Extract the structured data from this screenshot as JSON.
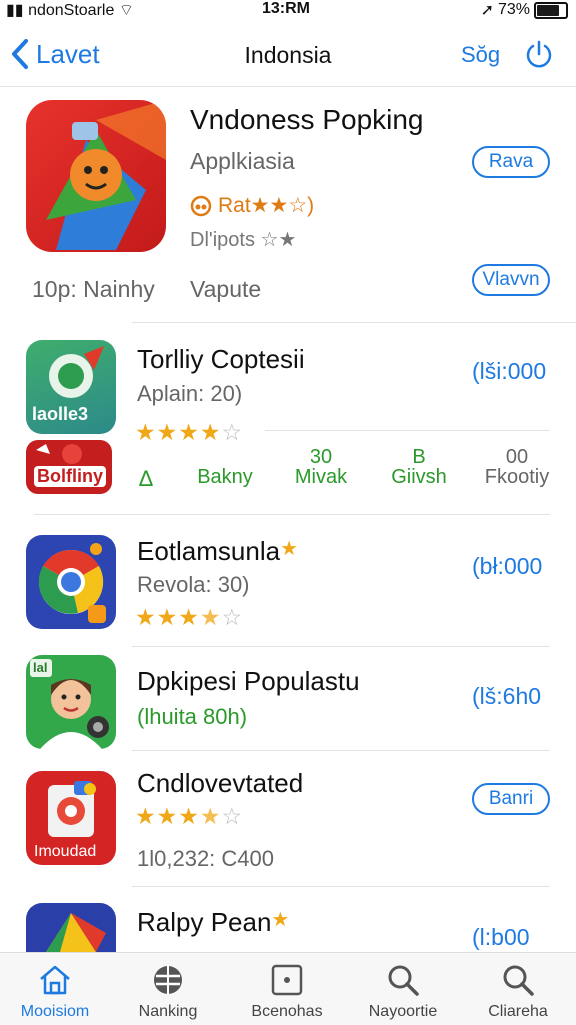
{
  "status_bar": {
    "carrier": "ndonStoarle",
    "time": "13:RM",
    "battery": "73%",
    "battery_level": 0.73
  },
  "nav": {
    "back_label": "Lavet",
    "title": "Indonsia",
    "sort_label": "Sŏg"
  },
  "featured": {
    "name": "Vndoness Popking",
    "category": "Applkiasia",
    "rating_text": "Rat★★☆)",
    "downloads": "Dl'ipots ☆★",
    "button_primary": "Rava",
    "button_secondary": "Vlavvn",
    "meta_left": "10p: Nainhy",
    "meta_right": "Vapute"
  },
  "apps": [
    {
      "name": "Torlliy Coptesii",
      "subtitle": "Aplain: 20)",
      "price": "(lši:000",
      "stars": 4,
      "icon_text": "laolle3"
    },
    {
      "name": "Eotlamsunla",
      "subtitle": "Revola: 30)",
      "price": "(bł:000",
      "stars": 3.5,
      "badge": "★"
    },
    {
      "name": "Dpkipesi Populastu",
      "subtitle": "(lhuita 80h)",
      "price": "(lš:6h0",
      "icon_text": "lal"
    },
    {
      "name": "Cndlovevtated",
      "subtitle": "1l0,232: C400",
      "price": "Banri",
      "stars": 3.5,
      "icon_text": "Imoudad"
    },
    {
      "name": "Ralpy Pean",
      "price": "(l:b00",
      "badge": "★"
    }
  ],
  "categories_row": {
    "banner_text": "Bolfliny",
    "items": [
      {
        "top": "",
        "label": "Δ"
      },
      {
        "top": "",
        "label": "Bakny"
      },
      {
        "top": "30",
        "label": "Mivak"
      },
      {
        "top": "B",
        "label": "Giivsh"
      },
      {
        "top": "00",
        "label": "Fkootiy"
      }
    ]
  },
  "tabs": [
    {
      "label": "Mooisiom",
      "icon": "home-icon",
      "active": true
    },
    {
      "label": "Nanking",
      "icon": "globe-icon"
    },
    {
      "label": "Bcenohas",
      "icon": "square-dot-icon"
    },
    {
      "label": "Nayoortie",
      "icon": "search-icon"
    },
    {
      "label": "Cliareha",
      "icon": "search-icon"
    }
  ],
  "colors": {
    "accent": "#1e7ae0",
    "star": "#f0a818",
    "green_text": "#2a9a2a",
    "rating_orange": "#e07a12"
  }
}
